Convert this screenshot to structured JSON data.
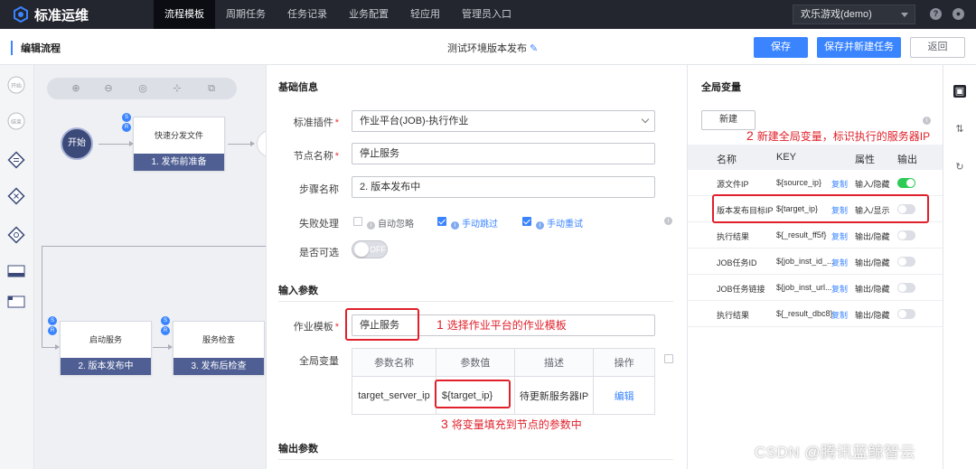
{
  "app": {
    "title": "标准运维"
  },
  "nav": [
    {
      "label": "流程模板",
      "active": true
    },
    {
      "label": "周期任务"
    },
    {
      "label": "任务记录"
    },
    {
      "label": "业务配置"
    },
    {
      "label": "轻应用"
    },
    {
      "label": "管理员入口"
    }
  ],
  "account": {
    "business": "欢乐游戏(demo)"
  },
  "subheader": {
    "title": "编辑流程",
    "flow_name": "测试环境版本发布",
    "save": "保存",
    "save_new_task": "保存并新建任务",
    "back": "返回"
  },
  "rail": {
    "start": "开始",
    "end": "结束"
  },
  "canvas": {
    "start_label": "开始",
    "nodes": [
      {
        "name": "快速分发文件",
        "stage": "1. 发布前准备"
      },
      {
        "name": "启动服务",
        "stage": "2. 版本发布中"
      },
      {
        "name": "服务检查",
        "stage": "3. 发布后检查"
      }
    ]
  },
  "basic": {
    "title": "基础信息",
    "plugin_label": "标准插件",
    "plugin_value": "作业平台(JOB)-执行作业",
    "node_name_label": "节点名称",
    "node_name_value": "停止服务",
    "step_name_label": "步骤名称",
    "step_name_value": "2. 版本发布中",
    "fail_label": "失败处理",
    "opt_auto_ignore": "自动忽略",
    "opt_manual_skip": "手动跳过",
    "opt_manual_retry": "手动重试",
    "optional_label": "是否可选",
    "optional_state": "OFF"
  },
  "input": {
    "title": "输入参数",
    "template_label": "作业模板",
    "template_value": "停止服务",
    "globals_label": "全局变量",
    "table": {
      "headers": [
        "参数名称",
        "参数值",
        "描述",
        "操作"
      ],
      "row": {
        "name": "target_server_ip",
        "value": "${target_ip}",
        "desc": "待更新服务器IP",
        "action": "编辑"
      }
    }
  },
  "output": {
    "title": "输出参数"
  },
  "annotations": {
    "a1_num": "1",
    "a1_text": "选择作业平台的作业模板",
    "a2_num": "2",
    "a2_text": "新建全局变量，标识执行的服务器IP",
    "a3_num": "3",
    "a3_text": "将变量填充到节点的参数中"
  },
  "vars": {
    "title": "全局变量",
    "new_button": "新建",
    "headers": {
      "name": "名称",
      "key": "KEY",
      "attr": "属性",
      "out": "输出"
    },
    "copy_label": "复制",
    "rows": [
      {
        "name": "源文件IP",
        "key": "${source_ip}",
        "attr": "输入/隐藏",
        "output": true
      },
      {
        "name": "版本发布目标IP",
        "key": "${target_ip}",
        "attr": "输入/显示",
        "output": false
      },
      {
        "name": "执行结果",
        "key": "${_result_ff5f}",
        "attr": "输出/隐藏",
        "output": false
      },
      {
        "name": "JOB任务ID",
        "key": "${job_inst_id_...",
        "attr": "输出/隐藏",
        "output": false
      },
      {
        "name": "JOB任务链接",
        "key": "${job_inst_url...",
        "attr": "输出/隐藏",
        "output": false
      },
      {
        "name": "执行结果",
        "key": "${_result_dbc8}",
        "attr": "输出/隐藏",
        "output": false
      }
    ]
  },
  "watermark": "CSDN @腾讯蓝鲸智云"
}
